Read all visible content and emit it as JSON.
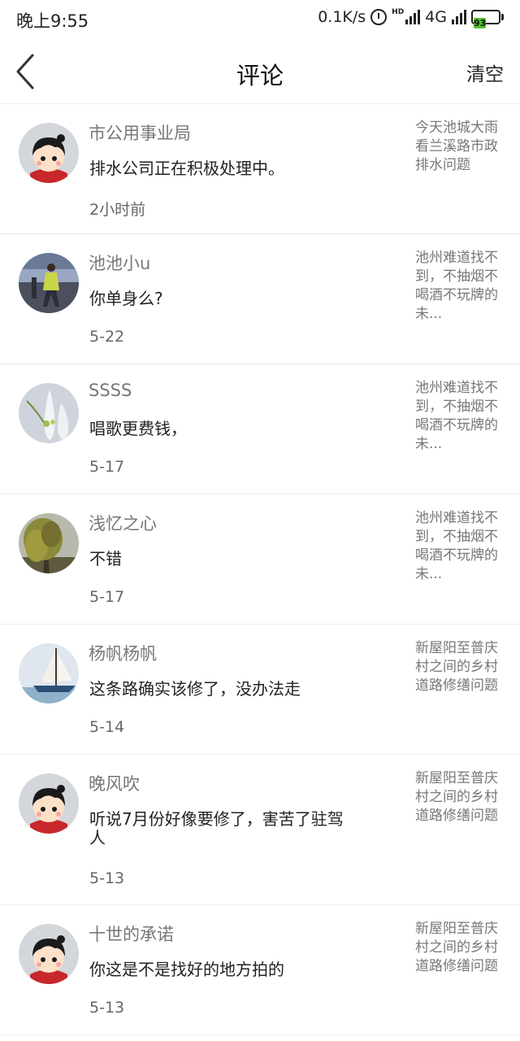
{
  "status_bar": {
    "time": "晚上9:55",
    "net_speed": "0.1K/s",
    "network": "4G",
    "battery": "93",
    "battery_color": "#54c22e"
  },
  "header": {
    "title": "评论",
    "clear_label": "清空"
  },
  "comments": [
    {
      "avatar": "cartoon-girl-avatar",
      "user": "市公用事业局",
      "text": "排水公司正在积极处理中。",
      "date": "2小时前",
      "topic": "今天池城大雨看兰溪路市政排水问题"
    },
    {
      "avatar": "street-photo-avatar",
      "user": "池池小u",
      "text": "你单身么?",
      "date": "5-22",
      "topic": "池州难道找不到，不抽烟不喝酒不玩牌的未..."
    },
    {
      "avatar": "vase-photo-avatar",
      "user": "SSSS",
      "text": "唱歌更费钱，",
      "date": "5-17",
      "topic": "池州难道找不到，不抽烟不喝酒不玩牌的未..."
    },
    {
      "avatar": "willow-tree-avatar",
      "user": "浅忆之心",
      "text": "不错",
      "date": "5-17",
      "topic": "池州难道找不到，不抽烟不喝酒不玩牌的未..."
    },
    {
      "avatar": "sailboat-avatar",
      "user": "杨帆杨帆",
      "text": "这条路确实该修了，没办法走",
      "date": "5-14",
      "topic": "新屋阳至普庆村之间的乡村道路修缮问题"
    },
    {
      "avatar": "cartoon-girl-avatar",
      "user": "晚风吹",
      "text": "听说7月份好像要修了，害苦了驻驾人",
      "date": "5-13",
      "topic": "新屋阳至普庆村之间的乡村道路修缮问题"
    },
    {
      "avatar": "cartoon-girl-avatar",
      "user": "十世的承诺",
      "text": "你这是不是找好的地方拍的",
      "date": "5-13",
      "topic": "新屋阳至普庆村之间的乡村道路修缮问题"
    }
  ]
}
